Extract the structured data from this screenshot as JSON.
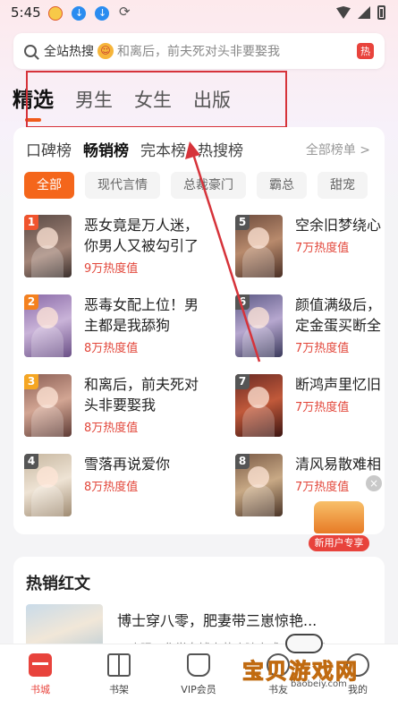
{
  "status_bar": {
    "time": "5:45"
  },
  "search": {
    "label": "全站热搜",
    "placeholder": "和离后，前夫死对头非要娶我",
    "hot_badge": "热"
  },
  "top_tabs": [
    {
      "label": "精选",
      "active": true
    },
    {
      "label": "男生",
      "active": false
    },
    {
      "label": "女生",
      "active": false
    },
    {
      "label": "出版",
      "active": false
    }
  ],
  "rank_tabs": [
    {
      "label": "口碑榜",
      "active": false
    },
    {
      "label": "畅销榜",
      "active": true
    },
    {
      "label": "完本榜",
      "active": false
    },
    {
      "label": "热搜榜",
      "active": false
    }
  ],
  "all_lists": "全部榜单 >",
  "chips": [
    {
      "label": "全部",
      "active": true
    },
    {
      "label": "现代言情",
      "active": false
    },
    {
      "label": "总裁豪门",
      "active": false
    },
    {
      "label": "霸总",
      "active": false
    },
    {
      "label": "甜宠",
      "active": false
    }
  ],
  "books": [
    {
      "rank": "1",
      "title": "恶女竟是万人迷，你男人又被勾引了",
      "heat": "9万热度值",
      "badge_color": "#f0542e"
    },
    {
      "rank": "2",
      "title": "恶毒女配上位！男主都是我舔狗",
      "heat": "8万热度值",
      "badge_color": "#f4811f"
    },
    {
      "rank": "3",
      "title": "和离后，前夫死对头非要娶我",
      "heat": "8万热度值",
      "badge_color": "#f5a623"
    },
    {
      "rank": "4",
      "title": "雪落再说爱你",
      "heat": "8万热度值",
      "badge_color": "#555555"
    },
    {
      "rank": "5",
      "title": "空余旧梦绕心",
      "heat": "7万热度值",
      "badge_color": "#555555"
    },
    {
      "rank": "6",
      "title": "颜值满级后，定金蛋买断全",
      "heat": "7万热度值",
      "badge_color": "#555555"
    },
    {
      "rank": "7",
      "title": "断鸿声里忆旧",
      "heat": "7万热度值",
      "badge_color": "#555555"
    },
    {
      "rank": "8",
      "title": "清风易散难相",
      "heat": "7万热度值",
      "badge_color": "#555555"
    }
  ],
  "promo": {
    "label": "新用户专享",
    "close": "×"
  },
  "hot_section": {
    "title": "热销红文",
    "book_title": "博士穿八零，肥妻带三崽惊艳...",
    "book_desc": "一晚眼，化学女博士苏晚晴穿成八十年代..."
  },
  "tab_bar": [
    {
      "label": "书城",
      "icon": "bookstore-icon",
      "active": true
    },
    {
      "label": "书架",
      "icon": "bookshelf-icon",
      "active": false
    },
    {
      "label": "VIP会员",
      "icon": "vip-icon",
      "active": false
    },
    {
      "label": "书友",
      "icon": "community-icon",
      "active": false
    },
    {
      "label": "我的",
      "icon": "profile-icon",
      "active": false
    }
  ],
  "watermark": {
    "brand": "宝贝游戏网",
    "url": "baobeiy.com"
  },
  "colors": {
    "accent": "#f4661b",
    "heat": "#e2463a",
    "annotation": "#d6333a"
  }
}
